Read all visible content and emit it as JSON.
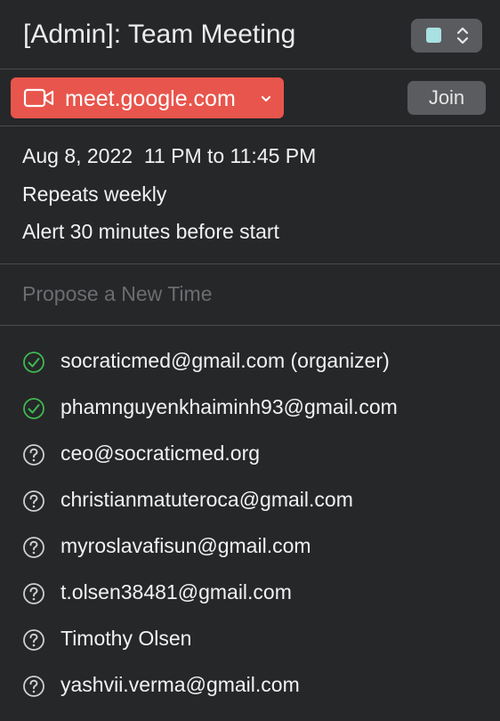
{
  "event": {
    "title": "[Admin]: Team Meeting",
    "calendar_color": "#a9e0e2"
  },
  "location": {
    "label": "meet.google.com",
    "icon": "video-camera-icon",
    "join_label": "Join",
    "accent": "#e8554c"
  },
  "details": {
    "datetime": "Aug 8, 2022  11 PM to 11:45 PM",
    "repeat": "Repeats weekly",
    "alert": "Alert 30 minutes before start"
  },
  "propose": {
    "placeholder": "Propose a New Time"
  },
  "attendees": [
    {
      "name": "socraticmed@gmail.com (organizer)",
      "status": "accepted"
    },
    {
      "name": "phamnguyenkhaiminh93@gmail.com",
      "status": "accepted"
    },
    {
      "name": "ceo@socraticmed.org",
      "status": "unknown"
    },
    {
      "name": "christianmatuteroca@gmail.com",
      "status": "unknown"
    },
    {
      "name": "myroslavafisun@gmail.com",
      "status": "unknown"
    },
    {
      "name": "t.olsen38481@gmail.com",
      "status": "unknown"
    },
    {
      "name": "Timothy Olsen",
      "status": "unknown"
    },
    {
      "name": "yashvii.verma@gmail.com",
      "status": "unknown"
    }
  ],
  "colors": {
    "accepted": "#3fb950",
    "unknown": "#d0d0d0"
  }
}
